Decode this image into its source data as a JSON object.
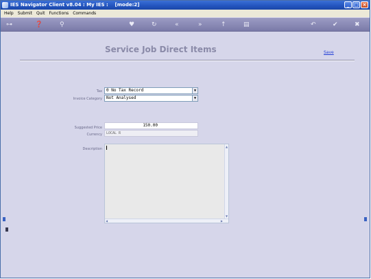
{
  "window": {
    "title": "IES Navigator Client v8.04 : My IES :",
    "mode": "[mode:2]",
    "controls": [
      "minimize",
      "maximize",
      "close"
    ]
  },
  "menu": [
    "Help",
    "Submit",
    "Quit",
    "Functions",
    "Commands"
  ],
  "toolbar": {
    "icons": [
      "key-icon",
      "help-icon",
      "search-icon",
      "heart-icon",
      "refresh-icon",
      "rewind-icon",
      "fast-forward-icon",
      "upload-icon",
      "list-icon",
      "back-icon",
      "check-icon",
      "close-icon"
    ]
  },
  "form": {
    "title": "Service Job Direct Items",
    "save_label": "Save",
    "tax_label": "Tax",
    "tax_value": "0 No Tax Record",
    "invoice_category_label": "Invoice Category",
    "invoice_category_value": "Not Analysed",
    "suggested_price_label": "Suggested Price",
    "suggested_price_value": "150.00",
    "currency_label": "Currency",
    "currency_value": "LOCAL R",
    "description_label": "Description",
    "description_value": ""
  }
}
